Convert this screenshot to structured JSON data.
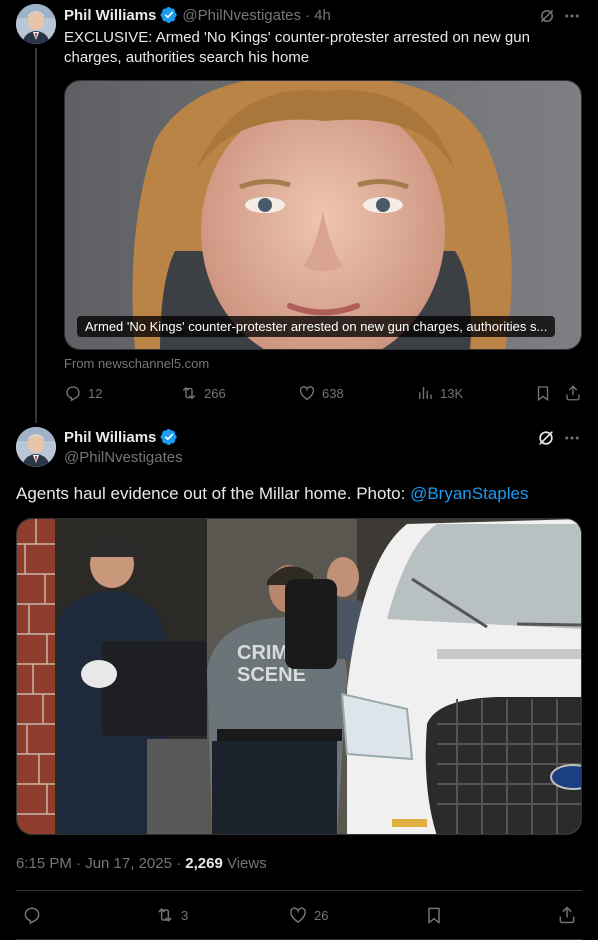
{
  "tweet1": {
    "name": "Phil Williams",
    "handle": "@PhilNvestigates",
    "time": "· 4h",
    "text": "EXCLUSIVE: Armed 'No Kings' counter-protester arrested on new gun charges, authorities search his home",
    "card_caption": "Armed 'No Kings' counter-protester arrested on new gun charges, authorities s...",
    "card_source": "From newschannel5.com",
    "replies": "12",
    "reposts": "266",
    "likes": "638",
    "views": "13K"
  },
  "tweet2": {
    "name": "Phil Williams",
    "handle": "@PhilNvestigates",
    "text_main": "Agents haul evidence out of the Millar home. Photo: ",
    "text_mention": "@BryanStaples",
    "photo_vest_text_1": "CRIM",
    "photo_vest_text_2": "SCENE",
    "timestamp": "6:15 PM · Jun 17, 2025 · ",
    "views_count": "2,269",
    "views_label": " Views",
    "reposts": "3",
    "likes": "26"
  },
  "colors": {
    "background": "#000000",
    "text": "#e7e9ea",
    "muted": "#71767b",
    "accent": "#1d9bf0",
    "divider": "#2f3336"
  },
  "icons": [
    "verified-icon",
    "grok-icon",
    "more-icon",
    "reply-icon",
    "repost-icon",
    "like-icon",
    "views-icon",
    "bookmark-icon",
    "share-icon"
  ]
}
